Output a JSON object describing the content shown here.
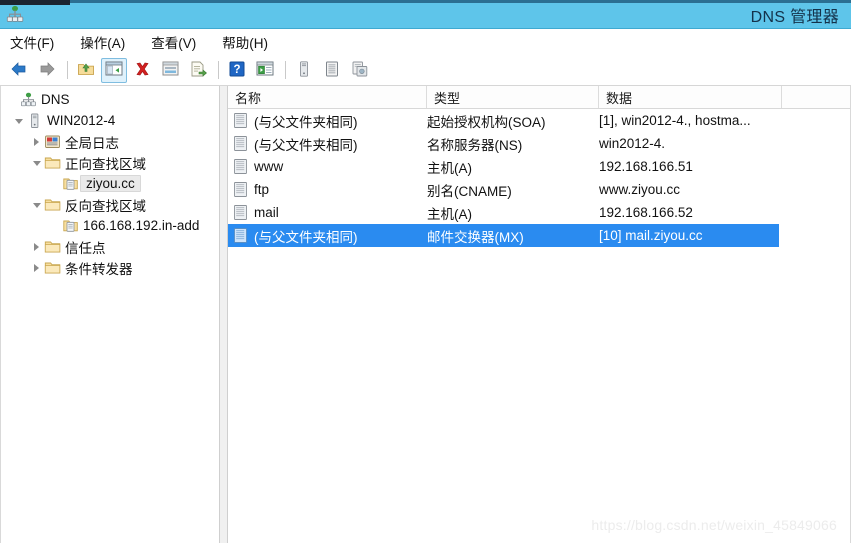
{
  "window": {
    "title": "DNS 管理器",
    "app_icon": "dns-server-icon"
  },
  "menubar": {
    "items": [
      {
        "label": "文件(F)",
        "name": "menu-file"
      },
      {
        "label": "操作(A)",
        "name": "menu-action"
      },
      {
        "label": "查看(V)",
        "name": "menu-view"
      },
      {
        "label": "帮助(H)",
        "name": "menu-help"
      }
    ]
  },
  "toolbar": {
    "buttons": [
      {
        "icon": "back-arrow-icon",
        "label": "后退"
      },
      {
        "icon": "forward-arrow-icon",
        "label": "前进"
      },
      {
        "icon": "up-folder-icon",
        "label": "向上一层"
      },
      {
        "icon": "show-hide-tree-icon",
        "label": "显示/隐藏控制台树",
        "active": true
      },
      {
        "icon": "delete-red-x-icon",
        "label": "删除"
      },
      {
        "icon": "properties-icon",
        "label": "属性"
      },
      {
        "icon": "export-list-icon",
        "label": "导出列表"
      },
      {
        "icon": "help-question-icon",
        "label": "帮助"
      },
      {
        "icon": "show-window-icon",
        "label": "显示窗口"
      },
      {
        "icon": "server-tower-icon",
        "label": "服务器"
      },
      {
        "icon": "new-zone-icon",
        "label": "新建区域"
      },
      {
        "icon": "refresh-zone-icon",
        "label": "刷新"
      }
    ]
  },
  "tree": {
    "nodes": [
      {
        "label": "DNS",
        "icon": "dns-root-icon",
        "indent": 0,
        "expander": "none",
        "selected": false
      },
      {
        "label": "WIN2012-4",
        "icon": "server-tower-icon",
        "indent": 1,
        "expander": "expanded",
        "selected": false
      },
      {
        "label": "全局日志",
        "icon": "global-log-icon",
        "indent": 2,
        "expander": "collapsed",
        "selected": false
      },
      {
        "label": "正向查找区域",
        "icon": "folder-icon",
        "indent": 2,
        "expander": "expanded",
        "selected": false
      },
      {
        "label": "ziyou.cc",
        "icon": "zone-icon",
        "indent": 3,
        "expander": "none",
        "selected": true
      },
      {
        "label": "反向查找区域",
        "icon": "folder-icon",
        "indent": 2,
        "expander": "expanded",
        "selected": false
      },
      {
        "label": "166.168.192.in-add",
        "icon": "zone-icon",
        "indent": 3,
        "expander": "none",
        "selected": false
      },
      {
        "label": "信任点",
        "icon": "folder-icon",
        "indent": 2,
        "expander": "collapsed",
        "selected": false
      },
      {
        "label": "条件转发器",
        "icon": "folder-icon",
        "indent": 2,
        "expander": "collapsed",
        "selected": false
      }
    ]
  },
  "list": {
    "columns": [
      "名称",
      "类型",
      "数据"
    ],
    "rows": [
      {
        "name": "(与父文件夹相同)",
        "type": "起始授权机构(SOA)",
        "data": "[1], win2012-4., hostma...",
        "selected": false
      },
      {
        "name": "(与父文件夹相同)",
        "type": "名称服务器(NS)",
        "data": "win2012-4.",
        "selected": false
      },
      {
        "name": "www",
        "type": "主机(A)",
        "data": "192.168.166.51",
        "selected": false
      },
      {
        "name": "ftp",
        "type": "别名(CNAME)",
        "data": "www.ziyou.cc",
        "selected": false
      },
      {
        "name": "mail",
        "type": "主机(A)",
        "data": "192.168.166.52",
        "selected": false
      },
      {
        "name": "(与父文件夹相同)",
        "type": "邮件交换器(MX)",
        "data": "[10]  mail.ziyou.cc",
        "selected": true
      }
    ]
  },
  "watermark": {
    "text": "https://blog.csdn.net/weixin_45849066"
  },
  "colors": {
    "titlebar": "#5ec5ea",
    "selection": "#2a8bf0",
    "folder": "#f5d997",
    "accent_blue": "#2a8bf0"
  }
}
